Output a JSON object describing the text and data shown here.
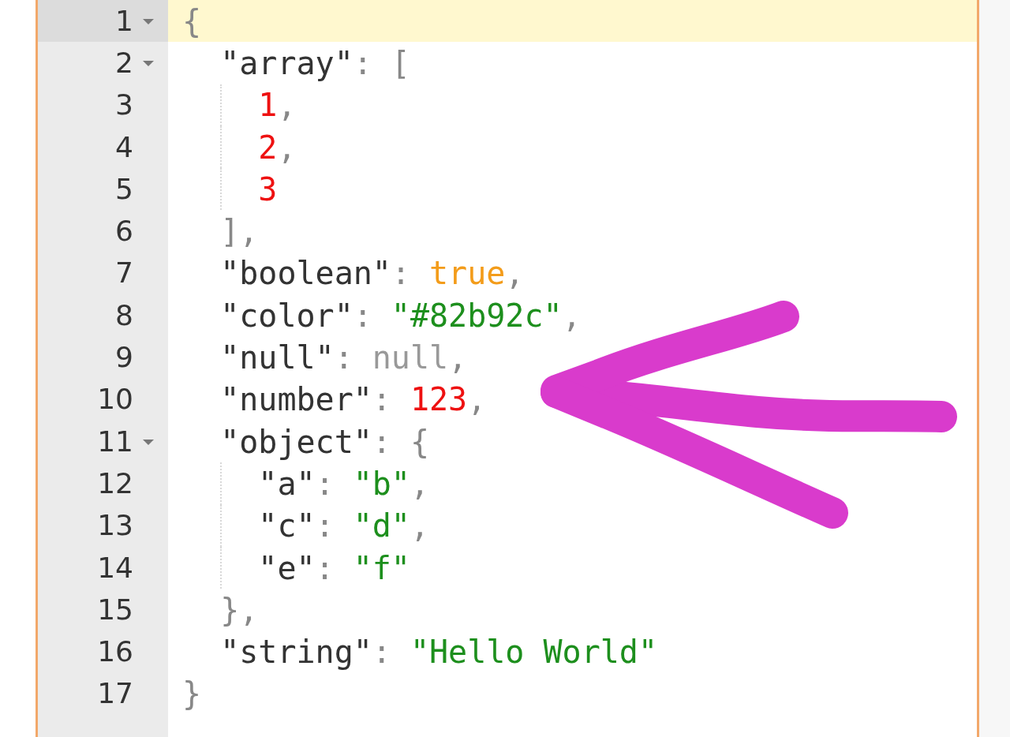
{
  "editor": {
    "lines": [
      {
        "number": "1",
        "active": true,
        "expanded": true,
        "tokens": [
          {
            "kind": "punct",
            "text": "{"
          }
        ],
        "children": [
          {
            "number": "2",
            "active": false,
            "expanded": true,
            "tokens": [
              {
                "kind": "key",
                "text": "\"array\""
              },
              {
                "kind": "colon",
                "text": ":"
              },
              {
                "kind": "punct",
                "text": "["
              }
            ],
            "children": [
              {
                "number": "3",
                "active": false,
                "tokens": [
                  {
                    "kind": "number",
                    "text": "1"
                  },
                  {
                    "kind": "punct",
                    "text": ","
                  }
                ]
              },
              {
                "number": "4",
                "active": false,
                "tokens": [
                  {
                    "kind": "number",
                    "text": "2"
                  },
                  {
                    "kind": "punct",
                    "text": ","
                  }
                ]
              },
              {
                "number": "5",
                "active": false,
                "tokens": [
                  {
                    "kind": "number",
                    "text": "3"
                  }
                ]
              }
            ]
          },
          {
            "number": "6",
            "active": false,
            "tokens": [
              {
                "kind": "punct",
                "text": "],"
              }
            ]
          },
          {
            "number": "7",
            "active": false,
            "tokens": [
              {
                "kind": "key",
                "text": "\"boolean\""
              },
              {
                "kind": "colon",
                "text": ":"
              },
              {
                "kind": "boolean",
                "text": "true"
              },
              {
                "kind": "punct",
                "text": ","
              }
            ]
          },
          {
            "number": "8",
            "active": false,
            "tokens": [
              {
                "kind": "key",
                "text": "\"color\""
              },
              {
                "kind": "colon",
                "text": ":"
              },
              {
                "kind": "string",
                "text": "\"#82b92c\""
              },
              {
                "kind": "punct",
                "text": ","
              }
            ]
          },
          {
            "number": "9",
            "active": false,
            "tokens": [
              {
                "kind": "key",
                "text": "\"null\""
              },
              {
                "kind": "colon",
                "text": ":"
              },
              {
                "kind": "null",
                "text": "null"
              },
              {
                "kind": "punct",
                "text": ","
              }
            ]
          },
          {
            "number": "10",
            "active": false,
            "tokens": [
              {
                "kind": "key",
                "text": "\"number\""
              },
              {
                "kind": "colon",
                "text": ":"
              },
              {
                "kind": "number",
                "text": "123"
              },
              {
                "kind": "punct",
                "text": ","
              }
            ]
          },
          {
            "number": "11",
            "active": false,
            "expanded": true,
            "tokens": [
              {
                "kind": "key",
                "text": "\"object\""
              },
              {
                "kind": "colon",
                "text": ":"
              },
              {
                "kind": "punct",
                "text": "{"
              }
            ],
            "children": [
              {
                "number": "12",
                "active": false,
                "tokens": [
                  {
                    "kind": "key",
                    "text": "\"a\""
                  },
                  {
                    "kind": "colon",
                    "text": ":"
                  },
                  {
                    "kind": "string",
                    "text": "\"b\""
                  },
                  {
                    "kind": "punct",
                    "text": ","
                  }
                ]
              },
              {
                "number": "13",
                "active": false,
                "tokens": [
                  {
                    "kind": "key",
                    "text": "\"c\""
                  },
                  {
                    "kind": "colon",
                    "text": ":"
                  },
                  {
                    "kind": "string",
                    "text": "\"d\""
                  },
                  {
                    "kind": "punct",
                    "text": ","
                  }
                ]
              },
              {
                "number": "14",
                "active": false,
                "tokens": [
                  {
                    "kind": "key",
                    "text": "\"e\""
                  },
                  {
                    "kind": "colon",
                    "text": ":"
                  },
                  {
                    "kind": "string",
                    "text": "\"f\""
                  }
                ]
              }
            ]
          },
          {
            "number": "15",
            "active": false,
            "tokens": [
              {
                "kind": "punct",
                "text": "},"
              }
            ]
          },
          {
            "number": "16",
            "active": false,
            "tokens": [
              {
                "kind": "key",
                "text": "\"string\""
              },
              {
                "kind": "colon",
                "text": ":"
              },
              {
                "kind": "string",
                "text": "\"Hello World\""
              }
            ]
          }
        ]
      },
      {
        "number": "17",
        "active": false,
        "tokens": [
          {
            "kind": "punct",
            "text": "}"
          }
        ]
      }
    ]
  }
}
